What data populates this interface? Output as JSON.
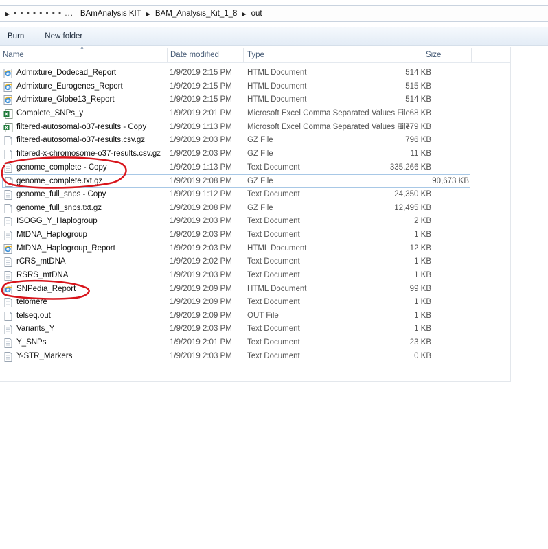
{
  "breadcrumb": {
    "redacted": "▪ ▪ ▪ ▪ ▪ ▪ ▪ ▪  ...",
    "items": [
      "BAmAnalysis KIT",
      "BAM_Analysis_Kit_1_8",
      "out"
    ]
  },
  "toolbar": {
    "burn_label": "Burn",
    "new_folder_label": "New folder"
  },
  "columns": {
    "name": "Name",
    "date": "Date modified",
    "type": "Type",
    "size": "Size"
  },
  "files": [
    {
      "name": "Admixture_Dodecad_Report",
      "date": "1/9/2019 2:15 PM",
      "type": "HTML Document",
      "size": "514 KB",
      "icon": "html"
    },
    {
      "name": "Admixture_Eurogenes_Report",
      "date": "1/9/2019 2:15 PM",
      "type": "HTML Document",
      "size": "515 KB",
      "icon": "html"
    },
    {
      "name": "Admixture_Globe13_Report",
      "date": "1/9/2019 2:15 PM",
      "type": "HTML Document",
      "size": "514 KB",
      "icon": "html"
    },
    {
      "name": "Complete_SNPs_y",
      "date": "1/9/2019 2:01 PM",
      "type": "Microsoft Excel Comma Separated Values File",
      "size": "68 KB",
      "icon": "excel"
    },
    {
      "name": "filtered-autosomal-o37-results - Copy",
      "date": "1/9/2019 1:13 PM",
      "type": "Microsoft Excel Comma Separated Values File",
      "size": "1,779 KB",
      "icon": "excel"
    },
    {
      "name": "filtered-autosomal-o37-results.csv.gz",
      "date": "1/9/2019 2:03 PM",
      "type": "GZ File",
      "size": "796 KB",
      "icon": "file"
    },
    {
      "name": "filtered-x-chromosome-o37-results.csv.gz",
      "date": "1/9/2019 2:03 PM",
      "type": "GZ File",
      "size": "11 KB",
      "icon": "file"
    },
    {
      "name": "genome_complete - Copy",
      "date": "1/9/2019 1:13 PM",
      "type": "Text Document",
      "size": "335,266 KB",
      "icon": "text"
    },
    {
      "name": "genome_complete.txt.gz",
      "date": "1/9/2019 2:08 PM",
      "type": "GZ File",
      "size": "90,673 KB",
      "icon": "file",
      "selected": true
    },
    {
      "name": "genome_full_snps - Copy",
      "date": "1/9/2019 1:12 PM",
      "type": "Text Document",
      "size": "24,350 KB",
      "icon": "text"
    },
    {
      "name": "genome_full_snps.txt.gz",
      "date": "1/9/2019 2:08 PM",
      "type": "GZ File",
      "size": "12,495 KB",
      "icon": "file"
    },
    {
      "name": "ISOGG_Y_Haplogroup",
      "date": "1/9/2019 2:03 PM",
      "type": "Text Document",
      "size": "2 KB",
      "icon": "text"
    },
    {
      "name": "MtDNA_Haplogroup",
      "date": "1/9/2019 2:03 PM",
      "type": "Text Document",
      "size": "1 KB",
      "icon": "text"
    },
    {
      "name": "MtDNA_Haplogroup_Report",
      "date": "1/9/2019 2:03 PM",
      "type": "HTML Document",
      "size": "12 KB",
      "icon": "html"
    },
    {
      "name": "rCRS_mtDNA",
      "date": "1/9/2019 2:02 PM",
      "type": "Text Document",
      "size": "1 KB",
      "icon": "text"
    },
    {
      "name": "RSRS_mtDNA",
      "date": "1/9/2019 2:03 PM",
      "type": "Text Document",
      "size": "1 KB",
      "icon": "text"
    },
    {
      "name": "SNPedia_Report",
      "date": "1/9/2019 2:09 PM",
      "type": "HTML Document",
      "size": "99 KB",
      "icon": "html"
    },
    {
      "name": "telomere",
      "date": "1/9/2019 2:09 PM",
      "type": "Text Document",
      "size": "1 KB",
      "icon": "text"
    },
    {
      "name": "telseq.out",
      "date": "1/9/2019 2:09 PM",
      "type": "OUT File",
      "size": "1 KB",
      "icon": "file"
    },
    {
      "name": "Variants_Y",
      "date": "1/9/2019 2:03 PM",
      "type": "Text Document",
      "size": "1 KB",
      "icon": "text"
    },
    {
      "name": "Y_SNPs",
      "date": "1/9/2019 2:01 PM",
      "type": "Text Document",
      "size": "23 KB",
      "icon": "text"
    },
    {
      "name": "Y-STR_Markers",
      "date": "1/9/2019 2:03 PM",
      "type": "Text Document",
      "size": "0 KB",
      "icon": "text"
    }
  ],
  "colors": {
    "annotation": "#d8141b",
    "selection_border": "#a8c8e6",
    "header_text": "#4c607a"
  },
  "icons": {
    "html": "ie-html-icon",
    "excel": "excel-csv-icon",
    "text": "text-document-icon",
    "file": "generic-file-icon"
  }
}
